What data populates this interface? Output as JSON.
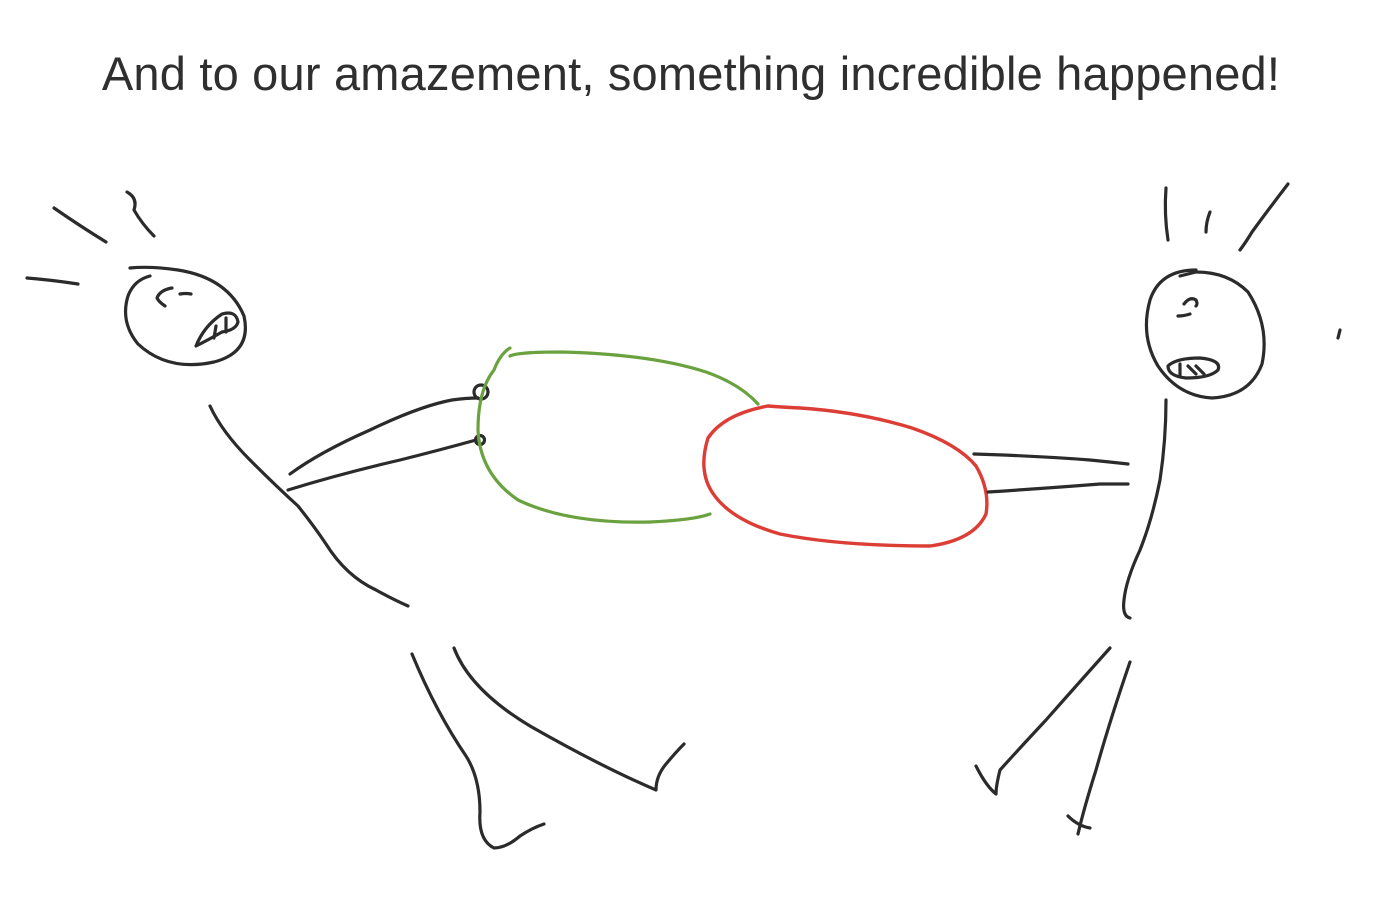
{
  "caption": "And to our amazement, something incredible happened!",
  "drawing": {
    "figures": [
      "stick-figure-left",
      "stick-figure-right"
    ],
    "shapes": [
      "green-oval",
      "red-oval"
    ],
    "colors": {
      "ink": "#2b2b2b",
      "green": "#6aa23f",
      "red": "#dc3d35",
      "text": "#2f2f2f",
      "background": "#ffffff"
    }
  }
}
